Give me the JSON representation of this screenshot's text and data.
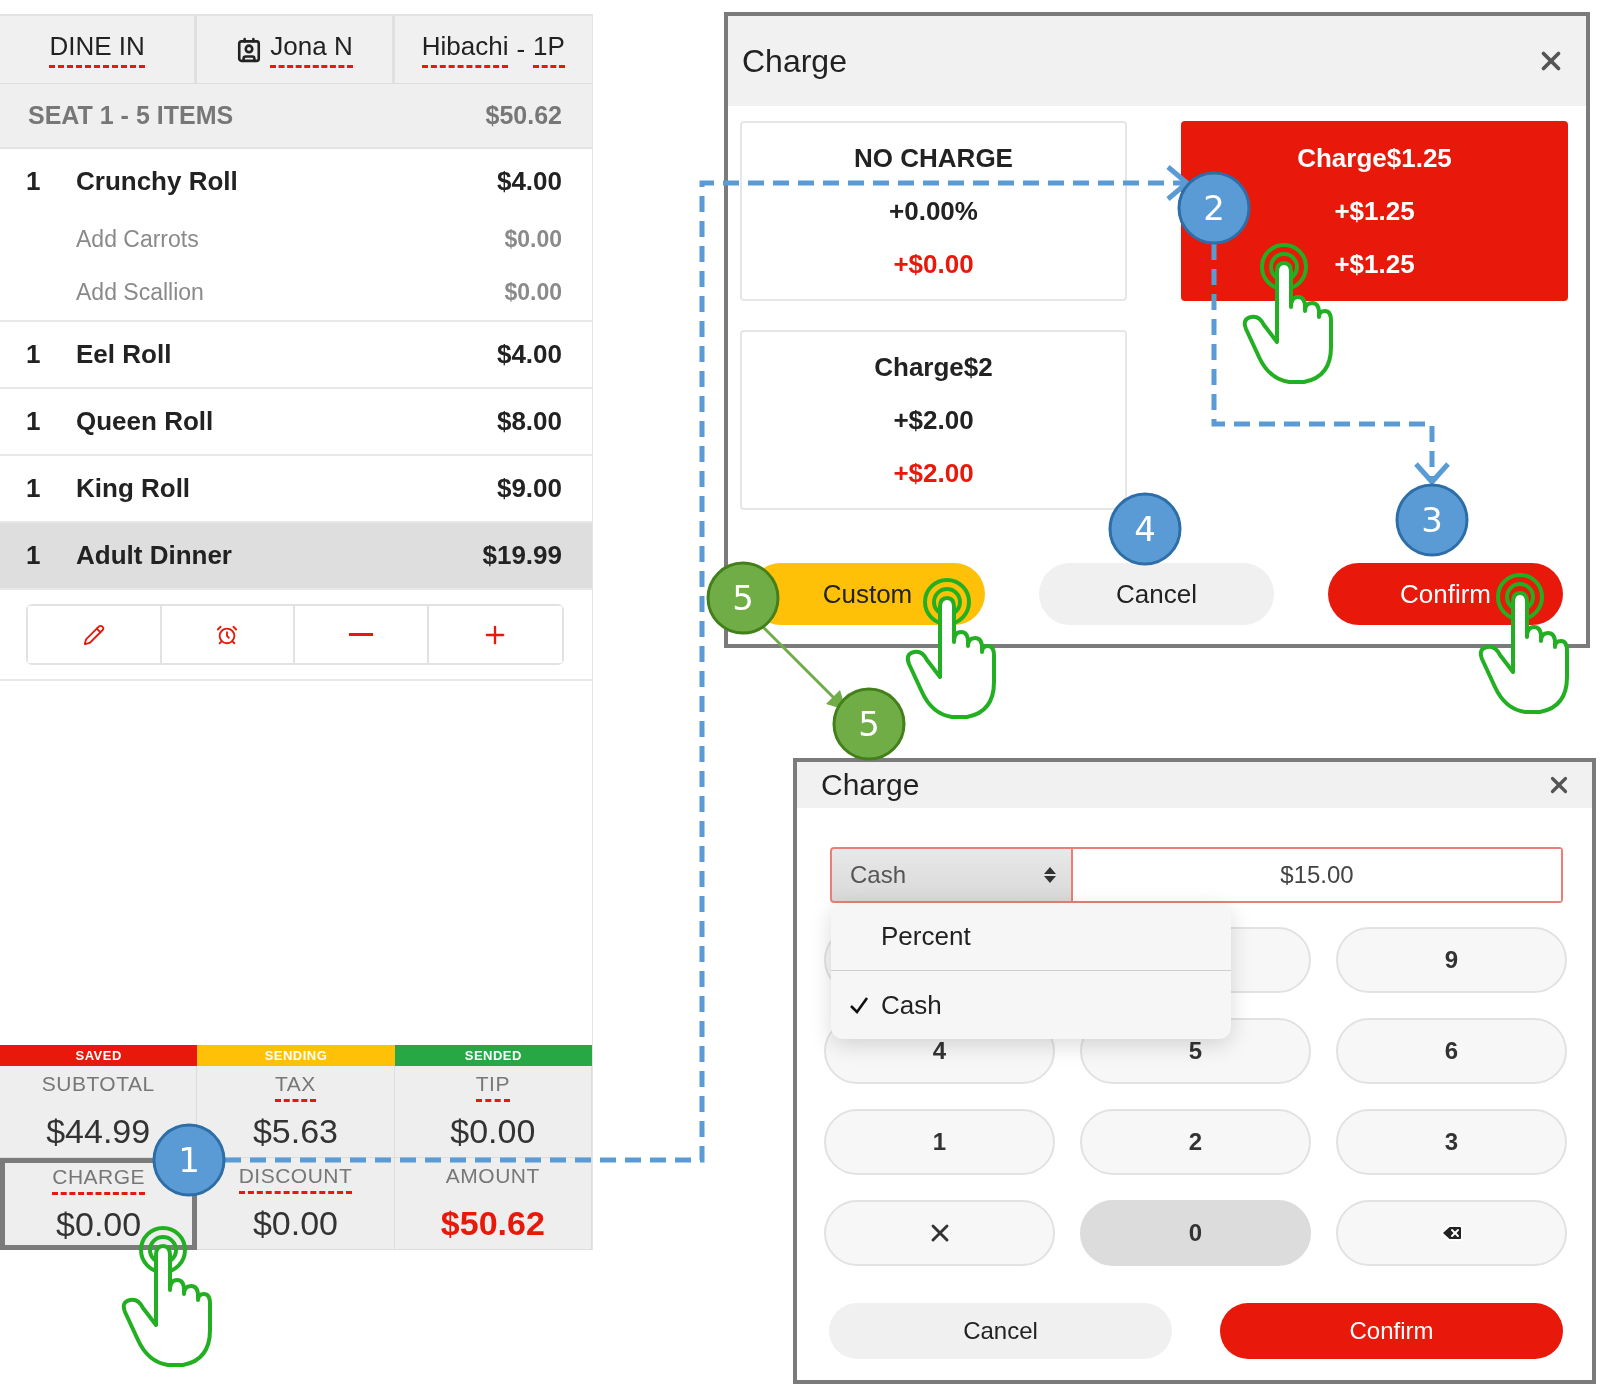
{
  "order_panel": {
    "header": [
      {
        "kind": "order_type",
        "label": "DINE IN"
      },
      {
        "kind": "customer",
        "label": "Jona N"
      },
      {
        "kind": "table",
        "label": "Hibachi",
        "separator": "-",
        "suffix": "1P"
      }
    ],
    "seat": {
      "label": "SEAT 1 - 5 ITEMS",
      "total": "$50.62"
    },
    "items": [
      {
        "qty": "1",
        "name": "Crunchy Roll",
        "price": "$4.00",
        "selected": false,
        "modifiers": [
          {
            "name": "Add Carrots",
            "price": "$0.00"
          },
          {
            "name": "Add Scallion",
            "price": "$0.00"
          }
        ]
      },
      {
        "qty": "1",
        "name": "Eel Roll",
        "price": "$4.00",
        "selected": false
      },
      {
        "qty": "1",
        "name": "Queen Roll",
        "price": "$8.00",
        "selected": false
      },
      {
        "qty": "1",
        "name": "King Roll",
        "price": "$9.00",
        "selected": false
      },
      {
        "qty": "1",
        "name": "Adult Dinner",
        "price": "$19.99",
        "selected": true
      }
    ],
    "status": [
      {
        "label": "SAVED",
        "color": "#e8190a"
      },
      {
        "label": "SENDING",
        "color": "#ffc107"
      },
      {
        "label": "SENDED",
        "color": "#28a745"
      }
    ],
    "totals": [
      {
        "label": "SUBTOTAL",
        "value": "$44.99",
        "underlined": false,
        "emphasis": false,
        "selected": false
      },
      {
        "label": "TAX",
        "value": "$5.63",
        "underlined": true,
        "emphasis": false,
        "selected": false
      },
      {
        "label": "TIP",
        "value": "$0.00",
        "underlined": true,
        "emphasis": false,
        "selected": false
      },
      {
        "label": "CHARGE",
        "value": "$0.00",
        "underlined": true,
        "emphasis": false,
        "selected": true
      },
      {
        "label": "DISCOUNT",
        "value": "$0.00",
        "underlined": true,
        "emphasis": false,
        "selected": false
      },
      {
        "label": "AMOUNT",
        "value": "$50.62",
        "underlined": false,
        "emphasis": true,
        "selected": false
      }
    ]
  },
  "charge_dialog": {
    "title": "Charge",
    "options": [
      {
        "title": "NO CHARGE",
        "line_1": "+0.00%",
        "line_2": "+$0.00",
        "selected": false
      },
      {
        "title": "Charge$1.25",
        "line_1": "+$1.25",
        "line_2": "+$1.25",
        "selected": true
      },
      {
        "title": "Charge$2",
        "line_1": "+$2.00",
        "line_2": "+$2.00",
        "selected": false
      }
    ],
    "buttons": [
      {
        "kind": "custom",
        "label": "Custom"
      },
      {
        "kind": "cancel",
        "label": "Cancel"
      },
      {
        "kind": "confirm",
        "label": "Confirm"
      }
    ]
  },
  "custom_dialog": {
    "title": "Charge",
    "type_select": "Cash",
    "amount": "$15.00",
    "menu": [
      {
        "label": "Percent",
        "selected": false
      },
      {
        "label": "Cash",
        "selected": true
      }
    ],
    "keypad": [
      {
        "kind": "blank"
      },
      {
        "kind": "blank"
      },
      {
        "kind": "digit",
        "label": "9",
        "pressed": false
      },
      {
        "kind": "digit",
        "label": "4",
        "pressed": false
      },
      {
        "kind": "digit",
        "label": "5",
        "pressed": false
      },
      {
        "kind": "digit",
        "label": "6",
        "pressed": false
      },
      {
        "kind": "digit",
        "label": "1",
        "pressed": false
      },
      {
        "kind": "digit",
        "label": "2",
        "pressed": false
      },
      {
        "kind": "digit",
        "label": "3",
        "pressed": false
      },
      {
        "kind": "clear"
      },
      {
        "kind": "digit",
        "label": "0",
        "pressed": true
      },
      {
        "kind": "backspace"
      }
    ],
    "buttons": [
      {
        "kind": "cancel",
        "label": "Cancel"
      },
      {
        "kind": "confirm",
        "label": "Confirm"
      }
    ]
  },
  "steps": [
    {
      "label": "1",
      "color": "#5b9bd5"
    },
    {
      "label": "2",
      "color": "#5b9bd5"
    },
    {
      "label": "3",
      "color": "#5b9bd5"
    },
    {
      "label": "4",
      "color": "#5b9bd5"
    },
    {
      "label": "5",
      "color": "#70ad47"
    },
    {
      "label": "5",
      "color": "#70ad47"
    }
  ]
}
